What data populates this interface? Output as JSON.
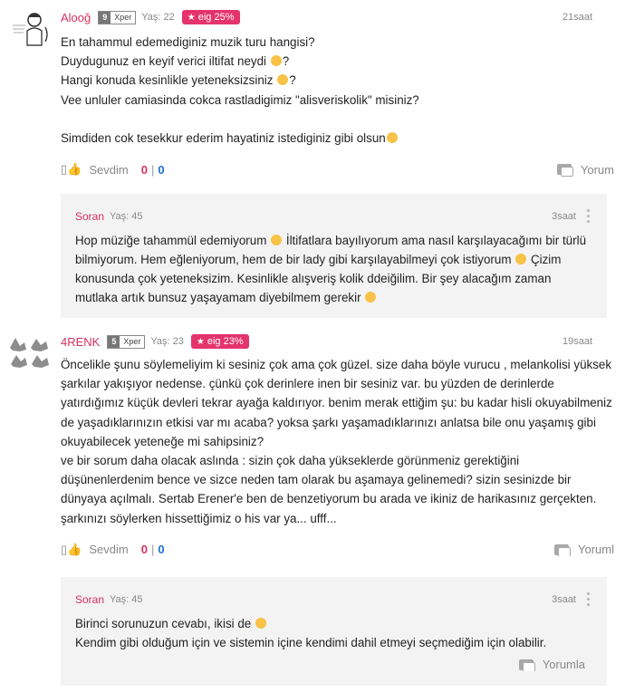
{
  "comments": [
    {
      "username": "Alooğ",
      "level": "9",
      "level_label": "Xper",
      "age": "Yaş: 22",
      "badge": "eig 25%",
      "time": "21saat",
      "lines": [
        "En tahammul edemediginiz muzik turu hangisi?",
        "Duydugunuz en keyif verici iltifat neydi",
        "Hangi konuda kesinlikle yeteneksizsiniz",
        "Vee unluler camiasinda cokca rastladigimiz \"alisveriskolik\" misiniz?",
        "",
        "Simdiden cok tesekkur ederim hayatiniz istediginiz gibi olsun"
      ],
      "line_suffix": [
        "",
        "?",
        "?",
        "",
        "",
        ""
      ],
      "like_label": "Sevdim",
      "likes": "0",
      "dislikes": "0",
      "reply_label": "Yorum",
      "reply": {
        "username": "Soran",
        "age": "Yaş: 45",
        "time": "3saat",
        "lines": [
          "Hop müziğe tahammül edemiyorum",
          "İltifatlara bayılıyorum ama nasıl karşılayacağımı bir türlü bilmiyorum. Hem eğleniyorum, hem de bir lady gibi karşılayabilmeyi çok istiyorum",
          "Çizim konusunda çok yeteneksizim. Kesinlikle alışveriş kolik ddeiğilim. Bir şey alacağım zaman mutlaka artık bunsuz yaşayamam diyebilmem gerekir"
        ]
      }
    },
    {
      "username": "4RENK",
      "level": "5",
      "level_label": "Xper",
      "age": "Yaş: 23",
      "badge": "eig 23%",
      "time": "19saat",
      "text": "Öncelikle şunu söylemeliyim ki sesiniz çok ama çok güzel. size daha böyle vurucu , melankolisi yüksek şarkılar yakışıyor nedense. çünkü çok derinlere inen bir sesiniz var. bu yüzden de derinlerde yatırdığımız küçük devleri tekrar ayağa kaldırıyor. benim merak ettiğim şu: bu kadar hisli okuyabilmeniz de yaşadıklarınızın etkisi var mı acaba? yoksa şarkı yaşamadıklarınızı anlatsa bile onu yaşamış gibi okuyabilecek yeteneğe mi sahipsiniz?\nve bir sorum daha olacak aslında : sizin çok daha yükseklerde görünmeniz gerektiğini düşünenlerdenim bence ve sizce neden tam olarak bu aşamaya gelinemedi? sizin sesinizde bir dünyaya açılmalı. Sertab Erener'e ben de benzetiyorum bu arada ve ikiniz de harikasınız gerçekten. şarkınızı söylerken hissettiğimiz o his var ya... ufff...",
      "like_label": "Sevdim",
      "likes": "0",
      "dislikes": "0",
      "reply_label": "Yoruml",
      "reply": {
        "username": "Soran",
        "age": "Yaş: 45",
        "time": "3saat",
        "line1": "Birinci sorunuzun cevabı, ikisi de",
        "line2": "Kendim gibi olduğum için ve sistemin içine kendimi dahil etmeyi seçmediğim için olabilir.",
        "reply_label": "Yorumla"
      }
    }
  ],
  "icons": {
    "star": "star-icon",
    "like": "thumbs-up-icon",
    "reply": "comment-bubbles-icon",
    "emoji": "smiley-emoji",
    "more": "more-vertical-icon"
  },
  "colors": {
    "username": "#d9305d",
    "badge": "#e5336c",
    "dislikes": "#1f6fd1",
    "reply_bg": "#f3f3f3",
    "emoji": "#f7c245"
  }
}
